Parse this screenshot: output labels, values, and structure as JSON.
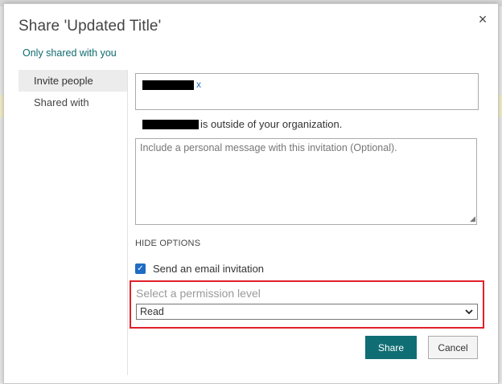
{
  "dialog": {
    "title": "Share 'Updated Title'",
    "close_icon": "×",
    "shared_link": "Only shared with you"
  },
  "nav": {
    "items": [
      {
        "label": "Invite people",
        "active": true
      },
      {
        "label": "Shared with",
        "active": false
      }
    ]
  },
  "invite": {
    "person_remove": "x",
    "warning_suffix": "is outside of your organization.",
    "message_placeholder": "Include a personal message with this invitation (Optional).",
    "hide_options": "HIDE OPTIONS",
    "email_invitation_label": "Send an email invitation",
    "email_invitation_checked": true,
    "permission_label": "Select a permission level",
    "permission_value": "Read"
  },
  "buttons": {
    "share": "Share",
    "cancel": "Cancel"
  },
  "colors": {
    "accent": "#0f6e74",
    "link": "#0f6b6f",
    "highlight_border": "#e0202b",
    "checkbox": "#1e6cc4"
  }
}
